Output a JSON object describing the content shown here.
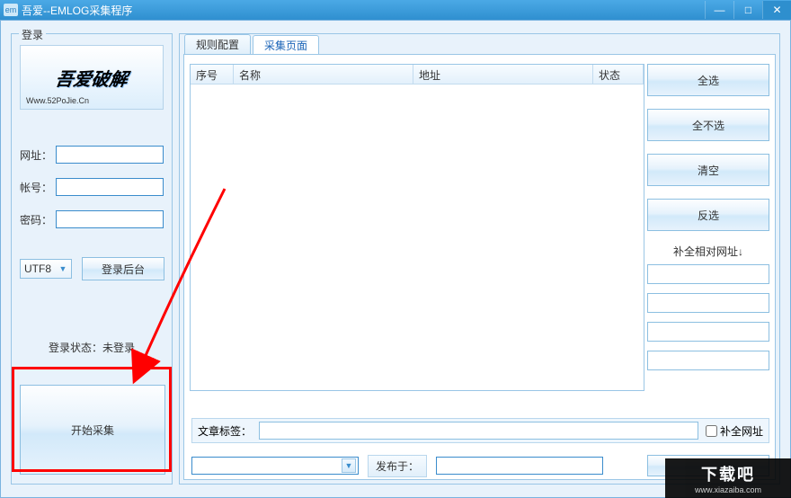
{
  "window": {
    "icon_text": "em",
    "title": "吾爱--EMLOG采集程序"
  },
  "login": {
    "legend": "登录",
    "logo_main": "吾爱破解",
    "logo_sub": "Www.52PoJie.Cn",
    "url_label": "网址：",
    "url_value": "",
    "user_label": "帐号：",
    "user_value": "",
    "pass_label": "密码：",
    "pass_value": "",
    "encoding": "UTF8",
    "login_btn": "登录后台",
    "status_prefix": "登录状态：",
    "status_value": "未登录",
    "start_btn": "开始采集"
  },
  "tabs": {
    "rule": "规则配置",
    "collect": "采集页面"
  },
  "list": {
    "col_index": "序号",
    "col_name": "名称",
    "col_addr": "地址",
    "col_status": "状态"
  },
  "side": {
    "select_all": "全选",
    "select_none": "全不选",
    "clear": "清空",
    "invert": "反选",
    "fill_label": "补全相对网址↓",
    "inp1": "",
    "inp2": "",
    "inp3": "",
    "inp4": ""
  },
  "bottom": {
    "tag_label": "文章标签：",
    "tag_value": "",
    "fill_url_chk": "补全网址",
    "combo_value": "",
    "publish_label": "发布于：",
    "publish_value": ""
  },
  "watermark": {
    "big": "下载吧",
    "small": "www.xiazaiba.com"
  }
}
